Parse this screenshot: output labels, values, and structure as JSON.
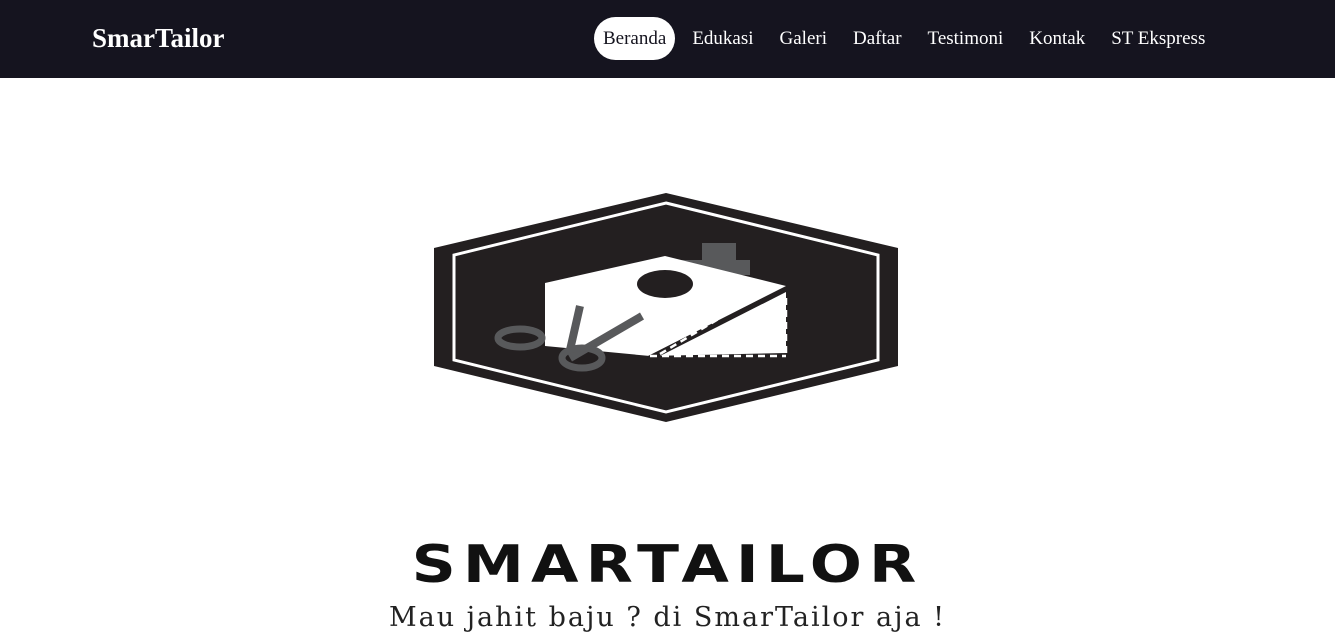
{
  "navbar": {
    "brand": "SmarTailor",
    "items": [
      {
        "label": "Beranda",
        "active": true
      },
      {
        "label": "Edukasi",
        "active": false
      },
      {
        "label": "Galeri",
        "active": false
      },
      {
        "label": "Daftar",
        "active": false
      },
      {
        "label": "Testimoni",
        "active": false
      },
      {
        "label": "Kontak",
        "active": false
      },
      {
        "label": "ST Ekspress",
        "active": false
      }
    ]
  },
  "hero": {
    "logo_icon": "scissors-fabric-hexagon-logo",
    "wordmark": "SMARTAILOR",
    "tagline": "Mau jahit baju ? di SmarTailor aja !"
  },
  "colors": {
    "navbar_bg": "#15141f",
    "logo_dark": "#231f20",
    "scissors_gray": "#58595b"
  }
}
